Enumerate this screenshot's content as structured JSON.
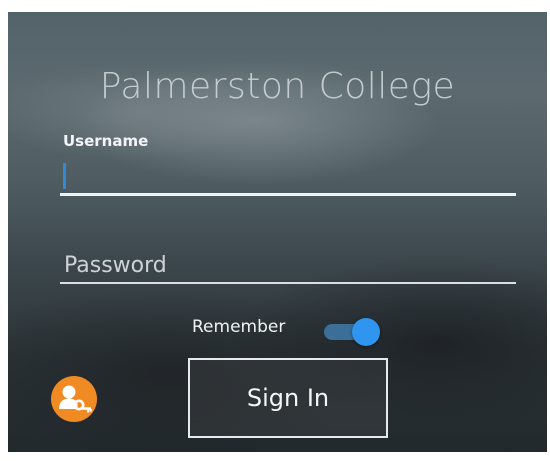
{
  "app": {
    "title": "Palmerston College"
  },
  "login": {
    "username_label": "Username",
    "username_value": "",
    "password_placeholder": "Password",
    "password_value": "",
    "remember_label": "Remember",
    "remember_on": true,
    "sign_in_label": "Sign In",
    "key_icon": "user-key-icon"
  },
  "colors": {
    "accent": "#2f95ee",
    "key_badge": "#f08a22",
    "text": "#f2f4f5"
  }
}
